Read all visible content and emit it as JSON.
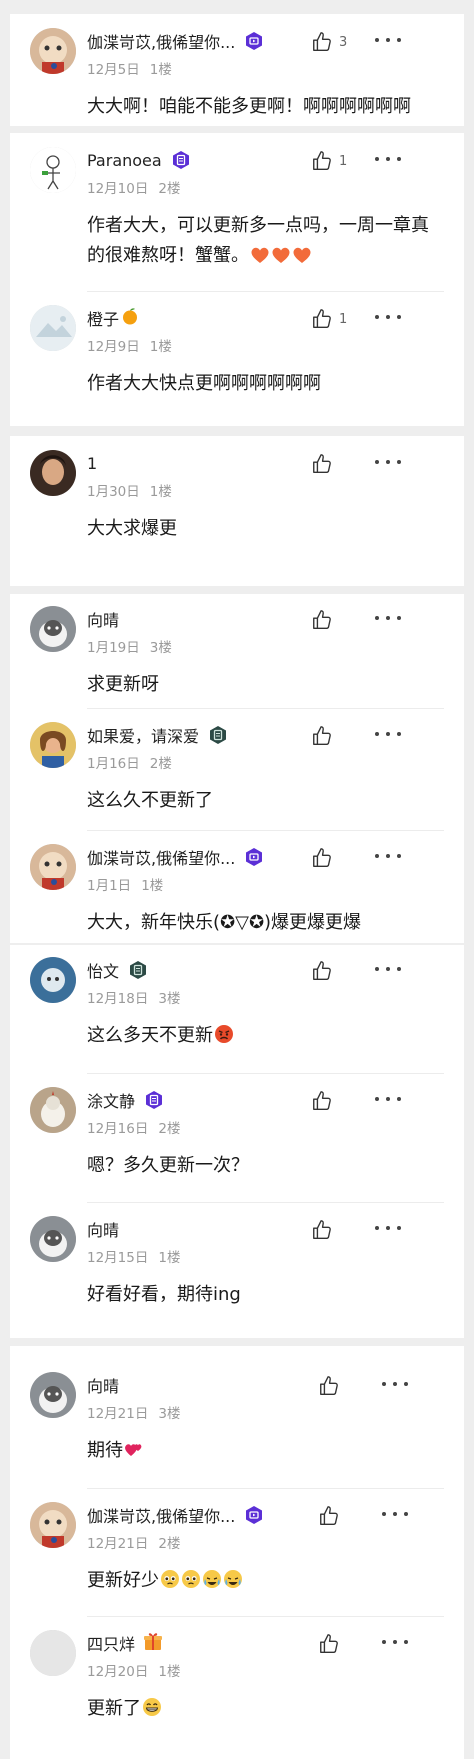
{
  "colors": {
    "page_background": "#eeeeee",
    "card_background": "#ffffff",
    "badge_purple": "#5b2fd6",
    "badge_dark": "#2c4a45",
    "meta_gray": "#9a9a9a"
  },
  "comments": [
    {
      "name": "伽渫岢苡,俄俙望你...",
      "date": "12月5日",
      "floor": "1楼",
      "text": "大大啊！咱能不能多更啊！啊啊啊啊啊啊",
      "likes": "3",
      "badge": "purple-video"
    },
    {
      "name": "Paranoea",
      "date": "12月10日",
      "floor": "2楼",
      "text": "作者大大，可以更新多一点吗，一周一章真的很难熬呀！蟹蟹。",
      "likes": "1",
      "badge": "purple-doc",
      "trailing_emoji": "orange-heart x3"
    },
    {
      "name": "橙子",
      "date": "12月9日",
      "floor": "1楼",
      "text": "作者大大快点更啊啊啊啊啊啊",
      "likes": "1",
      "name_emoji": "tangerine"
    },
    {
      "name": "1",
      "date": "1月30日",
      "floor": "1楼",
      "text": "大大求爆更",
      "likes": ""
    },
    {
      "name": "向晴",
      "date": "1月19日",
      "floor": "3楼",
      "text": "求更新呀",
      "likes": ""
    },
    {
      "name": "如果爱，请深爱",
      "date": "1月16日",
      "floor": "2楼",
      "text": "这么久不更新了",
      "likes": "",
      "badge": "dark-doc"
    },
    {
      "name": "伽渫岢苡,俄俙望你...",
      "date": "1月1日",
      "floor": "1楼",
      "text": "大大，新年快乐(✪▽✪)爆更爆更爆",
      "likes": "",
      "badge": "purple-video"
    },
    {
      "name": "怡文",
      "date": "12月18日",
      "floor": "3楼",
      "text": "这么多天不更新",
      "likes": "",
      "badge": "dark-doc",
      "trailing_emoji": "angry-face"
    },
    {
      "name": "涂文静",
      "date": "12月16日",
      "floor": "2楼",
      "text": "嗯？多久更新一次？",
      "likes": "",
      "badge": "purple-doc"
    },
    {
      "name": "向晴",
      "date": "12月15日",
      "floor": "1楼",
      "text": "好看好看，期待ing",
      "likes": ""
    },
    {
      "name": "向晴",
      "date": "12月21日",
      "floor": "3楼",
      "text": "期待",
      "likes": "",
      "trailing_emoji": "two-hearts"
    },
    {
      "name": "伽渫岢苡,俄俙望你...",
      "date": "12月21日",
      "floor": "2楼",
      "text": "更新好少",
      "likes": "",
      "badge": "purple-video",
      "trailing_emoji": "pleading-faces"
    },
    {
      "name": "四只烊",
      "date": "12月20日",
      "floor": "1楼",
      "text": "更新了",
      "likes": "",
      "name_emoji": "gift-box",
      "trailing_emoji": "grinning-face"
    }
  ]
}
